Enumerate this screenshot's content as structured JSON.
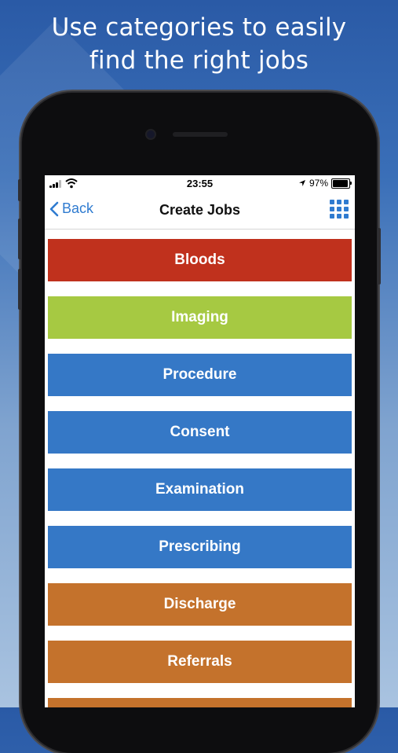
{
  "promo": {
    "headline_line1": "Use categories to easily",
    "headline_line2": "find the right jobs"
  },
  "status_bar": {
    "time": "23:55",
    "battery": "97%"
  },
  "nav": {
    "back_label": "Back",
    "title": "Create Jobs",
    "grid_icon": "grid-icon"
  },
  "colors": {
    "accent": "#2f7bd0",
    "red": "#c0311d",
    "green": "#a6c942",
    "blue": "#3578c6",
    "orange": "#c4722c"
  },
  "categories": [
    {
      "label": "Bloods",
      "color": "#c0311d"
    },
    {
      "label": "Imaging",
      "color": "#a6c942"
    },
    {
      "label": "Procedure",
      "color": "#3578c6"
    },
    {
      "label": "Consent",
      "color": "#3578c6"
    },
    {
      "label": "Examination",
      "color": "#3578c6"
    },
    {
      "label": "Prescribing",
      "color": "#3578c6"
    },
    {
      "label": "Discharge",
      "color": "#c4722c"
    },
    {
      "label": "Referrals",
      "color": "#c4722c"
    },
    {
      "label": "",
      "color": "#c4722c"
    }
  ]
}
